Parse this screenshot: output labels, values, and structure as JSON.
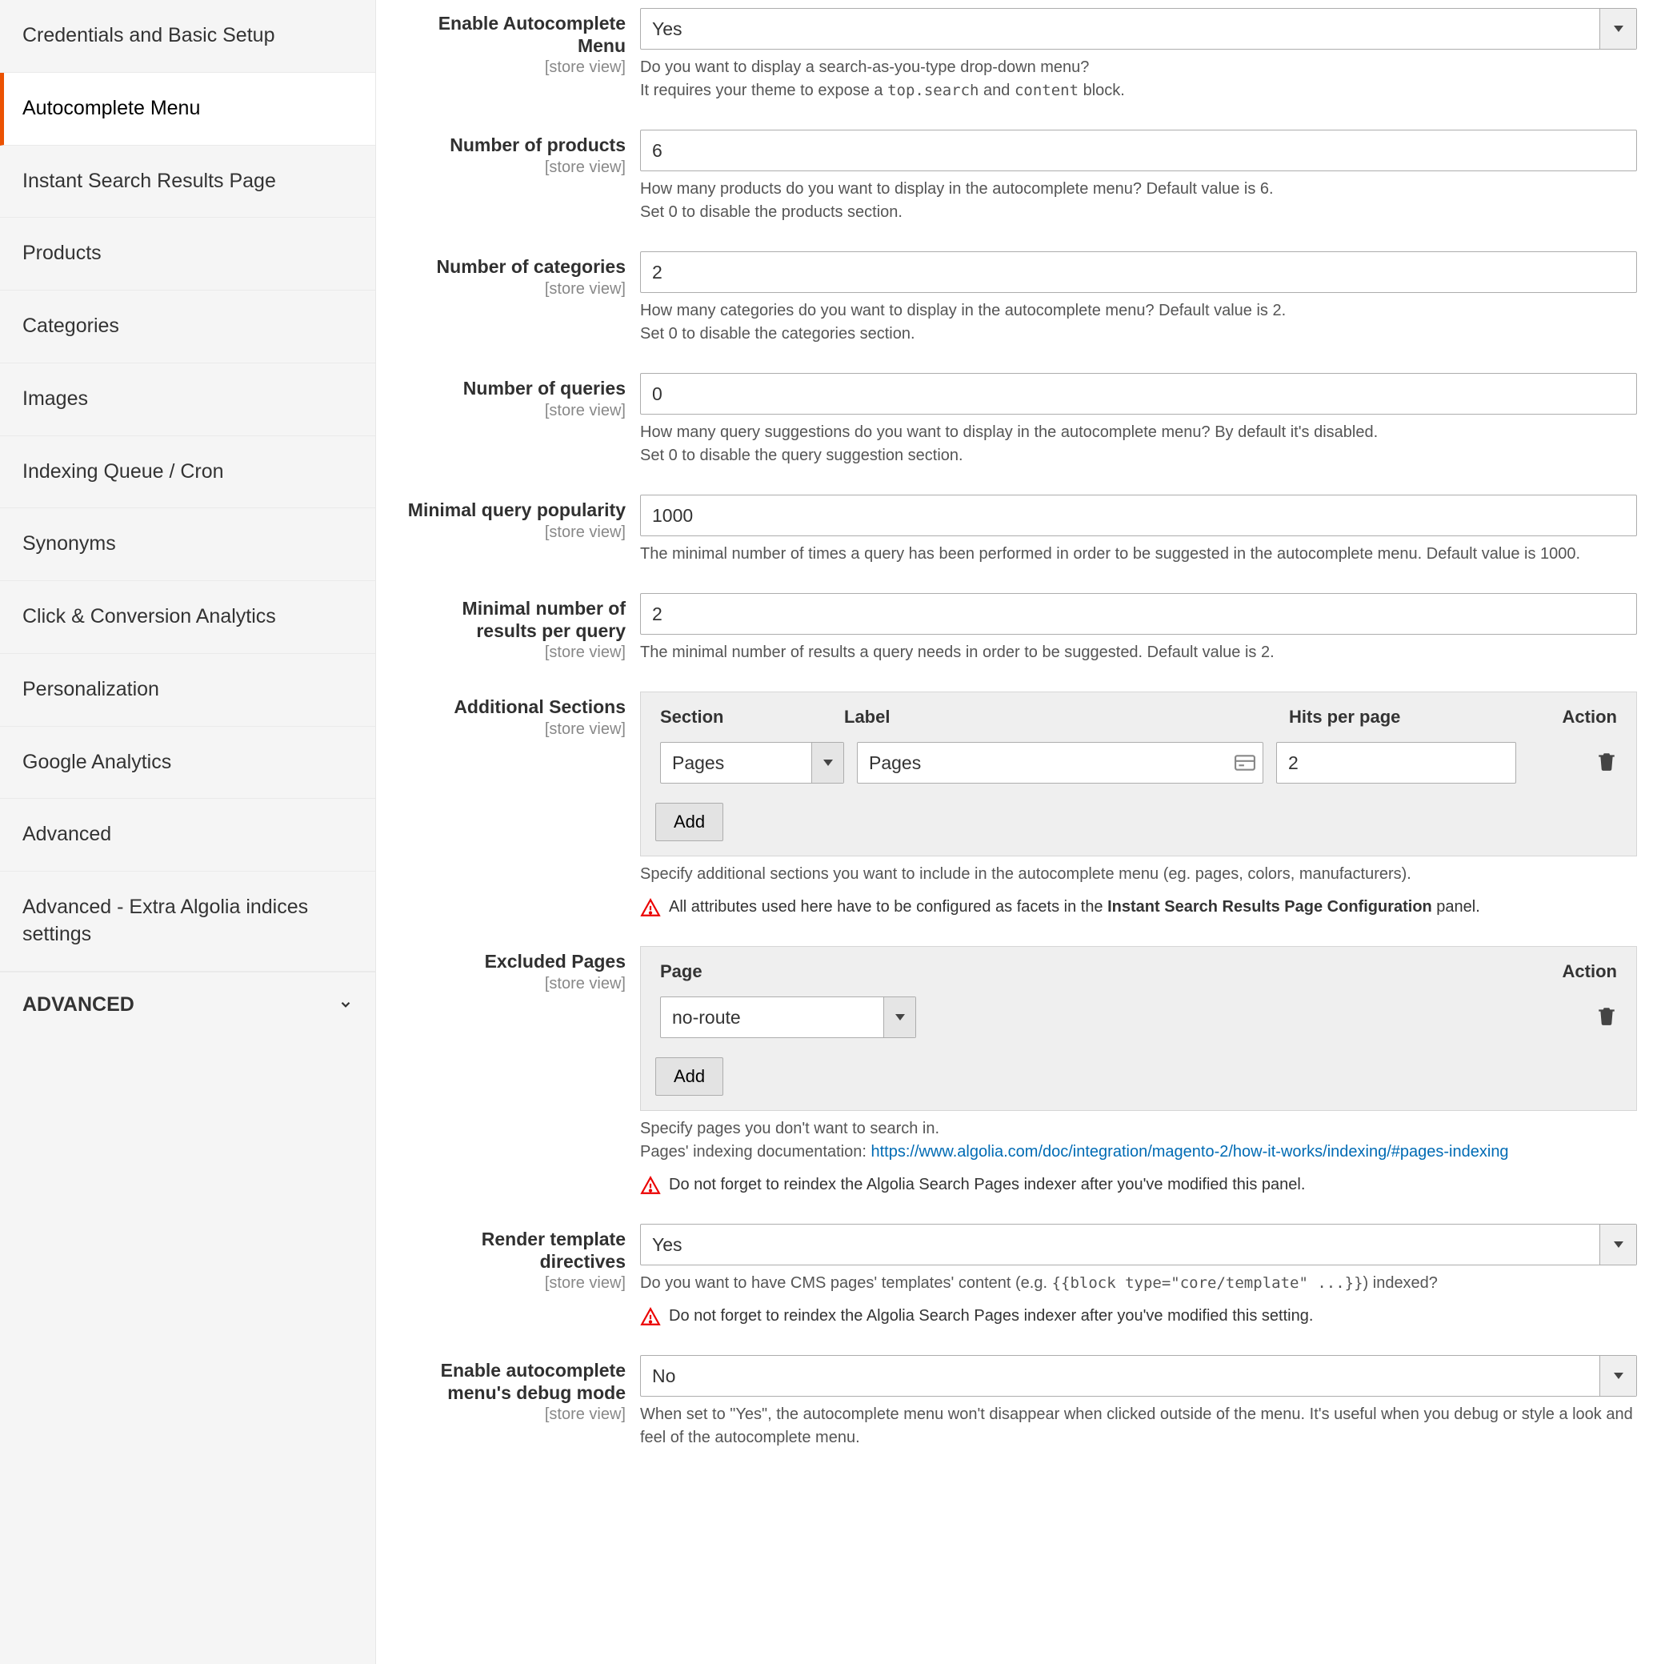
{
  "sidebar": {
    "tabs": [
      {
        "label": "Credentials and Basic Setup"
      },
      {
        "label": "Autocomplete Menu"
      },
      {
        "label": "Instant Search Results Page"
      },
      {
        "label": "Products"
      },
      {
        "label": "Categories"
      },
      {
        "label": "Images"
      },
      {
        "label": "Indexing Queue / Cron"
      },
      {
        "label": "Synonyms"
      },
      {
        "label": "Click & Conversion Analytics"
      },
      {
        "label": "Personalization"
      },
      {
        "label": "Google Analytics"
      },
      {
        "label": "Advanced"
      },
      {
        "label": "Advanced - Extra Algolia indices settings"
      }
    ],
    "active_index": 1,
    "group_header": "ADVANCED"
  },
  "scope_label": "[store view]",
  "fields": {
    "enable_autocomplete": {
      "label": "Enable Autocomplete Menu",
      "value": "Yes",
      "hint_l1": "Do you want to display a search-as-you-type drop-down menu?",
      "hint_l2_pre": "It requires your theme to expose a ",
      "hint_l2_code1": "top.search",
      "hint_l2_mid": " and ",
      "hint_l2_code2": "content",
      "hint_l2_post": " block."
    },
    "num_products": {
      "label": "Number of products",
      "value": "6",
      "hint_l1": "How many products do you want to display in the autocomplete menu? Default value is 6.",
      "hint_l2": "Set 0 to disable the products section."
    },
    "num_categories": {
      "label": "Number of categories",
      "value": "2",
      "hint_l1": "How many categories do you want to display in the autocomplete menu? Default value is 2.",
      "hint_l2": "Set 0 to disable the categories section."
    },
    "num_queries": {
      "label": "Number of queries",
      "value": "0",
      "hint_l1": "How many query suggestions do you want to display in the autocomplete menu? By default it's disabled.",
      "hint_l2": "Set 0 to disable the query suggestion section."
    },
    "min_popularity": {
      "label": "Minimal query popularity",
      "value": "1000",
      "hint": "The minimal number of times a query has been performed in order to be suggested in the autocomplete menu. Default value is 1000."
    },
    "min_results": {
      "label": "Minimal number of results per query",
      "value": "2",
      "hint": "The minimal number of results a query needs in order to be suggested. Default value is 2."
    },
    "additional_sections": {
      "label": "Additional Sections",
      "headers": {
        "section": "Section",
        "label": "Label",
        "hits": "Hits per page",
        "action": "Action"
      },
      "rows": [
        {
          "section": "Pages",
          "label_val": "Pages",
          "hits": "2"
        }
      ],
      "add_btn": "Add",
      "hint": "Specify additional sections you want to include in the autocomplete menu (eg. pages, colors, manufacturers).",
      "warn_pre": "All attributes used here have to be configured as facets in the ",
      "warn_bold": "Instant Search Results Page Configuration",
      "warn_post": " panel."
    },
    "excluded_pages": {
      "label": "Excluded Pages",
      "headers": {
        "page": "Page",
        "action": "Action"
      },
      "rows": [
        {
          "page": "no-route"
        }
      ],
      "add_btn": "Add",
      "hint_l1": "Specify pages you don't want to search in.",
      "hint_l2_pre": "Pages' indexing documentation: ",
      "hint_l2_link": "https://www.algolia.com/doc/integration/magento-2/how-it-works/indexing/#pages-indexing",
      "warn": "Do not forget to reindex the Algolia Search Pages indexer after you've modified this panel."
    },
    "render_template": {
      "label": "Render template directives",
      "value": "Yes",
      "hint_pre": "Do you want to have CMS pages' templates' content (e.g. ",
      "hint_code": "{{block type=\"core/template\" ...}}",
      "hint_post": ") indexed?",
      "warn": "Do not forget to reindex the Algolia Search Pages indexer after you've modified this setting."
    },
    "debug_mode": {
      "label": "Enable autocomplete menu's debug mode",
      "value": "No",
      "hint": "When set to \"Yes\", the autocomplete menu won't disappear when clicked outside of the menu. It's useful when you debug or style a look and feel of the autocomplete menu."
    }
  }
}
